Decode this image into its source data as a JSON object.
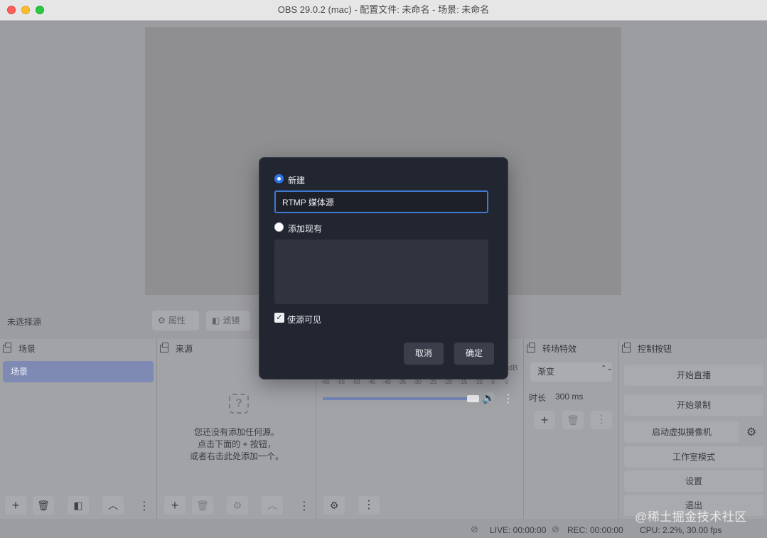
{
  "window": {
    "title": "OBS 29.0.2 (mac) - 配置文件: 未命名 - 场景: 未命名"
  },
  "source_toolbar": {
    "no_source_label": "未选择源",
    "properties_label": "属性",
    "filters_label": "滤镜"
  },
  "docks": {
    "scenes": {
      "title": "场景",
      "items": [
        "场景"
      ]
    },
    "sources": {
      "title": "来源",
      "empty_line1": "您还没有添加任何源。",
      "empty_line2": "点击下面的 + 按钮，",
      "empty_line3": "或者右击此处添加一个。"
    },
    "mixer": {
      "db_label": "dB",
      "ticks": [
        "-60",
        "-55",
        "-50",
        "-45",
        "-40",
        "-35",
        "-30",
        "-25",
        "-20",
        "-15",
        "-10",
        "-5",
        "0"
      ],
      "volume": 0.96
    },
    "transitions": {
      "title": "转场特效",
      "selected": "渐变",
      "duration_label": "时长",
      "duration_value": "300 ms"
    },
    "controls": {
      "title": "控制按钮",
      "start_streaming": "开始直播",
      "start_recording": "开始录制",
      "start_virtual_camera": "启动虚拟摄像机",
      "studio_mode": "工作室模式",
      "settings": "设置",
      "exit": "退出"
    }
  },
  "status": {
    "live": "LIVE: 00:00:00",
    "rec": "REC: 00:00:00",
    "cpu": "CPU: 2.2%, 30.00 fps"
  },
  "dialog": {
    "new_label": "新建",
    "name_value": "RTMP 媒体源",
    "add_existing_label": "添加现有",
    "visible_label": "使源可见",
    "cancel": "取消",
    "ok": "确定"
  },
  "watermark": "@稀土掘金技术社区",
  "colors": {
    "accent": "#2b74e4",
    "dialog_bg": "#222631",
    "selected_scene": "#7f8ab4"
  }
}
